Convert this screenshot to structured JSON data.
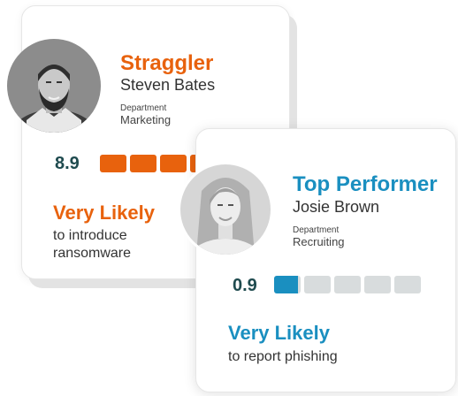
{
  "colors": {
    "straggler_accent": "#e8620d",
    "performer_accent": "#1a8fc0",
    "score_text": "#1f4b4f",
    "bar_empty": "#d8dcdd"
  },
  "straggler": {
    "title": "Straggler",
    "name": "Steven Bates",
    "department_label": "Department",
    "department": "Marketing",
    "score": "8.9",
    "risk_level": 0.89,
    "likelihood": "Very Likely",
    "outcome_line1": "to introduce",
    "outcome_line2": "ransomware"
  },
  "performer": {
    "title": "Top Performer",
    "name": "Josie Brown",
    "department_label": "Department",
    "department": "Recruiting",
    "score": "0.9",
    "risk_level": 0.09,
    "likelihood": "Very Likely",
    "outcome_line1": "to report phishing"
  }
}
